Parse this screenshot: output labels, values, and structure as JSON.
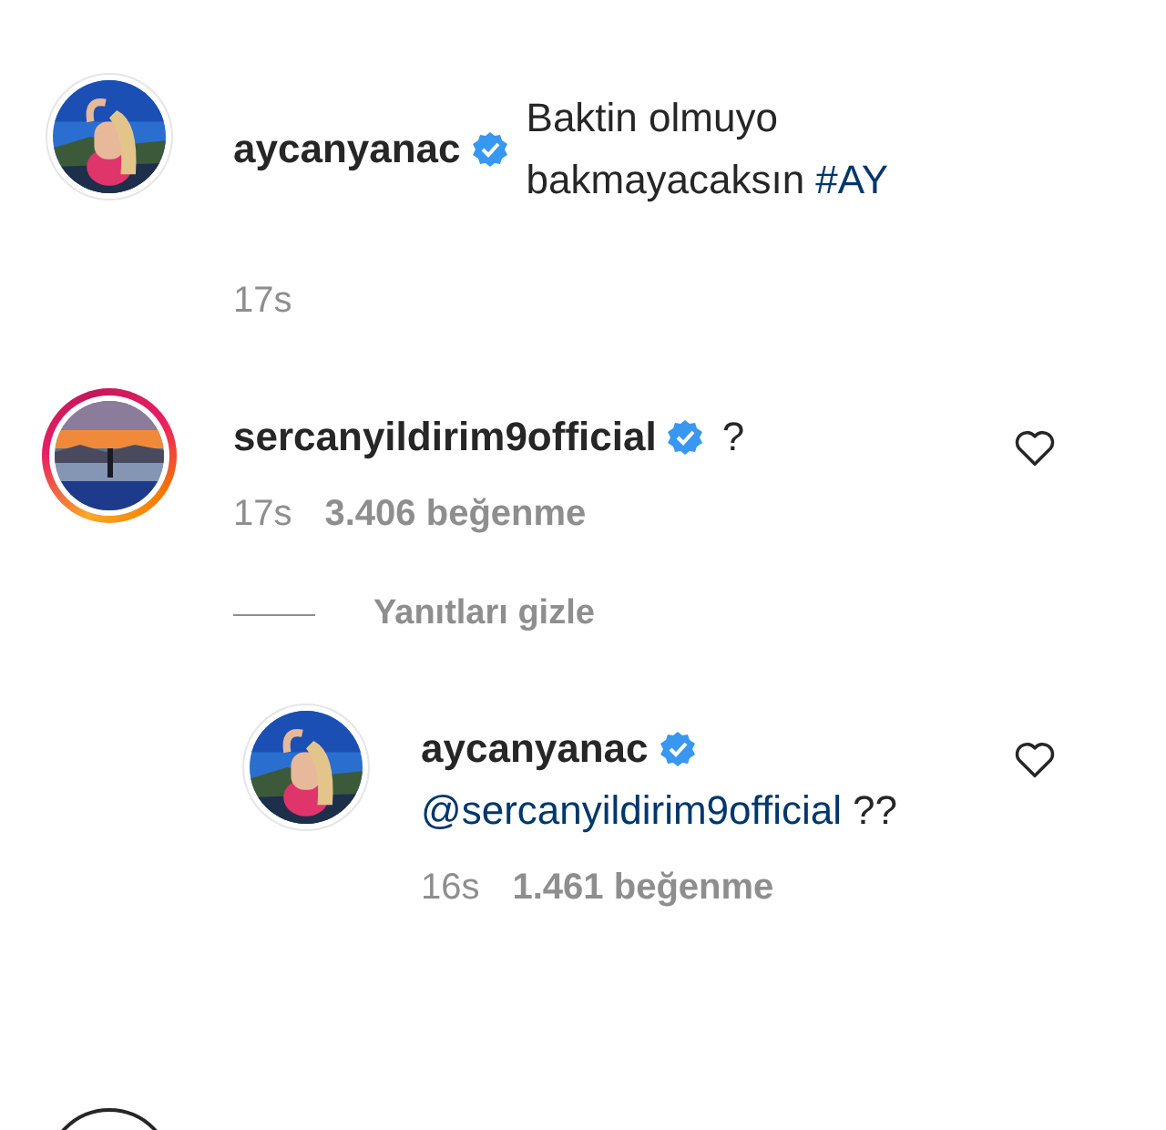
{
  "comments": [
    {
      "username": "aycanyanac",
      "verified": true,
      "avatar": {
        "kind": "picture",
        "story_ring": false
      },
      "body": [
        {
          "kind": "text",
          "text": "Baktin olmuyo bakmayacaksın"
        },
        {
          "kind": "link",
          "text": "#AY"
        }
      ],
      "time": "17s"
    },
    {
      "username": "sercanyildirim9official",
      "verified": true,
      "avatar": {
        "kind": "picture",
        "story_ring": true
      },
      "body": [
        {
          "kind": "text",
          "text": "?"
        }
      ],
      "time": "17s",
      "likes": "3.406 beğenme",
      "liked": false,
      "replies_toggle": "Yanıtları gizle",
      "replies": [
        {
          "username": "aycanyanac",
          "verified": true,
          "avatar": {
            "kind": "picture",
            "story_ring": false
          },
          "body": [
            {
              "kind": "link",
              "text": "@sercanyildirim9official"
            },
            {
              "kind": "text",
              "text": "??"
            }
          ],
          "time": "16s",
          "likes": "1.461 beğenme",
          "liked": false
        }
      ]
    }
  ]
}
